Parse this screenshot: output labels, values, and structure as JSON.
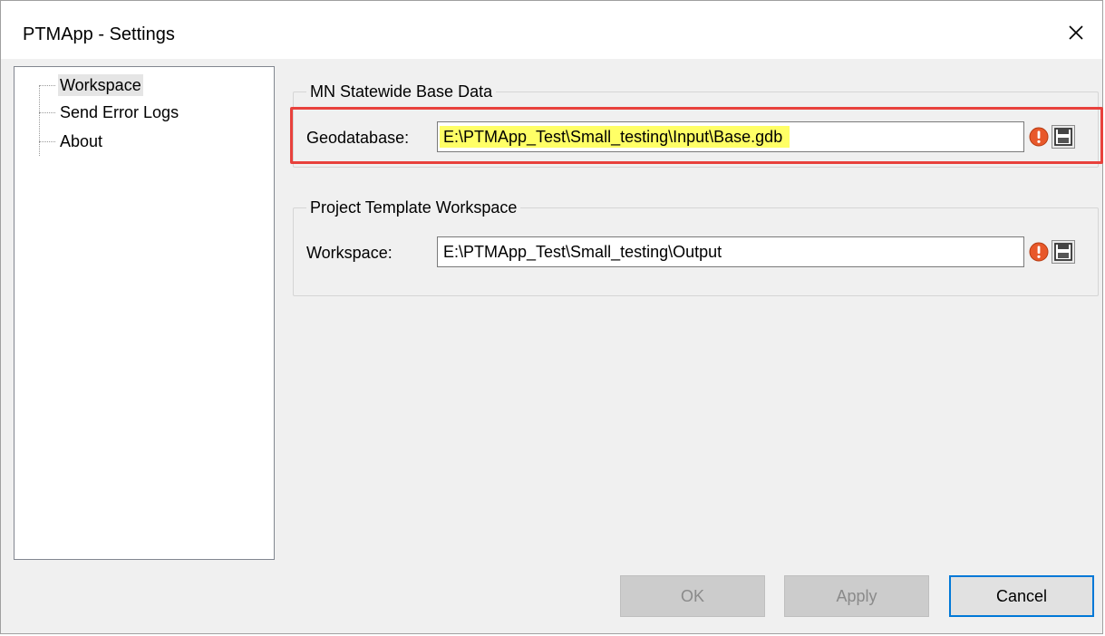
{
  "window": {
    "title": "PTMApp - Settings"
  },
  "tree": {
    "items": [
      {
        "label": "Workspace",
        "selected": true
      },
      {
        "label": "Send Error Logs",
        "selected": false
      },
      {
        "label": "About",
        "selected": false
      }
    ]
  },
  "base_data": {
    "legend": "MN Statewide Base Data",
    "label": "Geodatabase:",
    "value": "E:\\PTMApp_Test\\Small_testing\\Input\\Base.gdb"
  },
  "project_template": {
    "legend": "Project Template Workspace",
    "label": "Workspace:",
    "value": "E:\\PTMApp_Test\\Small_testing\\Output"
  },
  "buttons": {
    "ok": "OK",
    "apply": "Apply",
    "cancel": "Cancel"
  },
  "icons": {
    "warning": "warning-icon",
    "save": "save-icon",
    "close": "close-icon"
  },
  "colors": {
    "highlight_border": "#e8413c",
    "highlight_fill": "#ffff66",
    "focus_border": "#0078d7",
    "warning": "#e8582a"
  }
}
